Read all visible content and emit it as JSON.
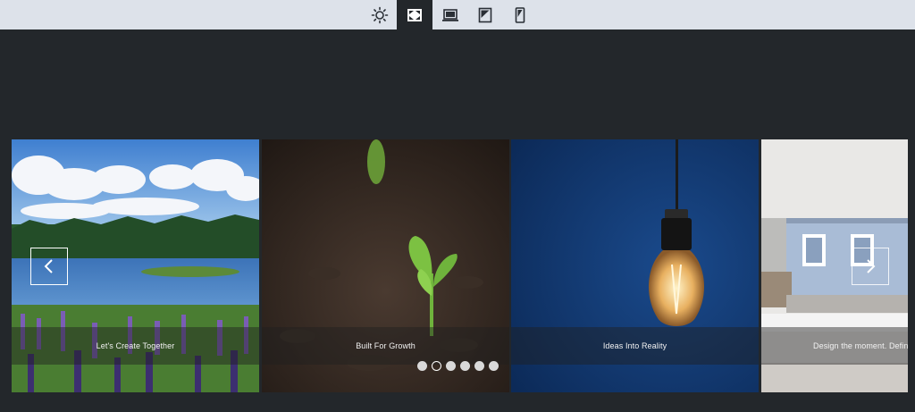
{
  "toolbar": {
    "items": [
      {
        "icon": "sun-icon",
        "active": false
      },
      {
        "icon": "fullscreen-icon",
        "active": true
      },
      {
        "icon": "laptop-icon",
        "active": false
      },
      {
        "icon": "tablet-icon",
        "active": false
      },
      {
        "icon": "mobile-icon",
        "active": false
      }
    ]
  },
  "carousel": {
    "slides": [
      {
        "caption": "Let's Create Together",
        "image": "lake-landscape"
      },
      {
        "caption": "Built For Growth",
        "image": "seedling-in-soil"
      },
      {
        "caption": "Ideas Into Reality",
        "image": "light-bulb"
      },
      {
        "caption": "Design the moment. Define",
        "image": "house-facade"
      }
    ],
    "prev_icon": "chevron-left-icon",
    "next_icon": "chevron-right-icon",
    "dots": {
      "count": 6,
      "active_index": 1
    }
  },
  "colors": {
    "background": "#23272b",
    "toolbar": "#dde2ea",
    "caption_overlay": "rgba(30,30,30,0.45)"
  }
}
